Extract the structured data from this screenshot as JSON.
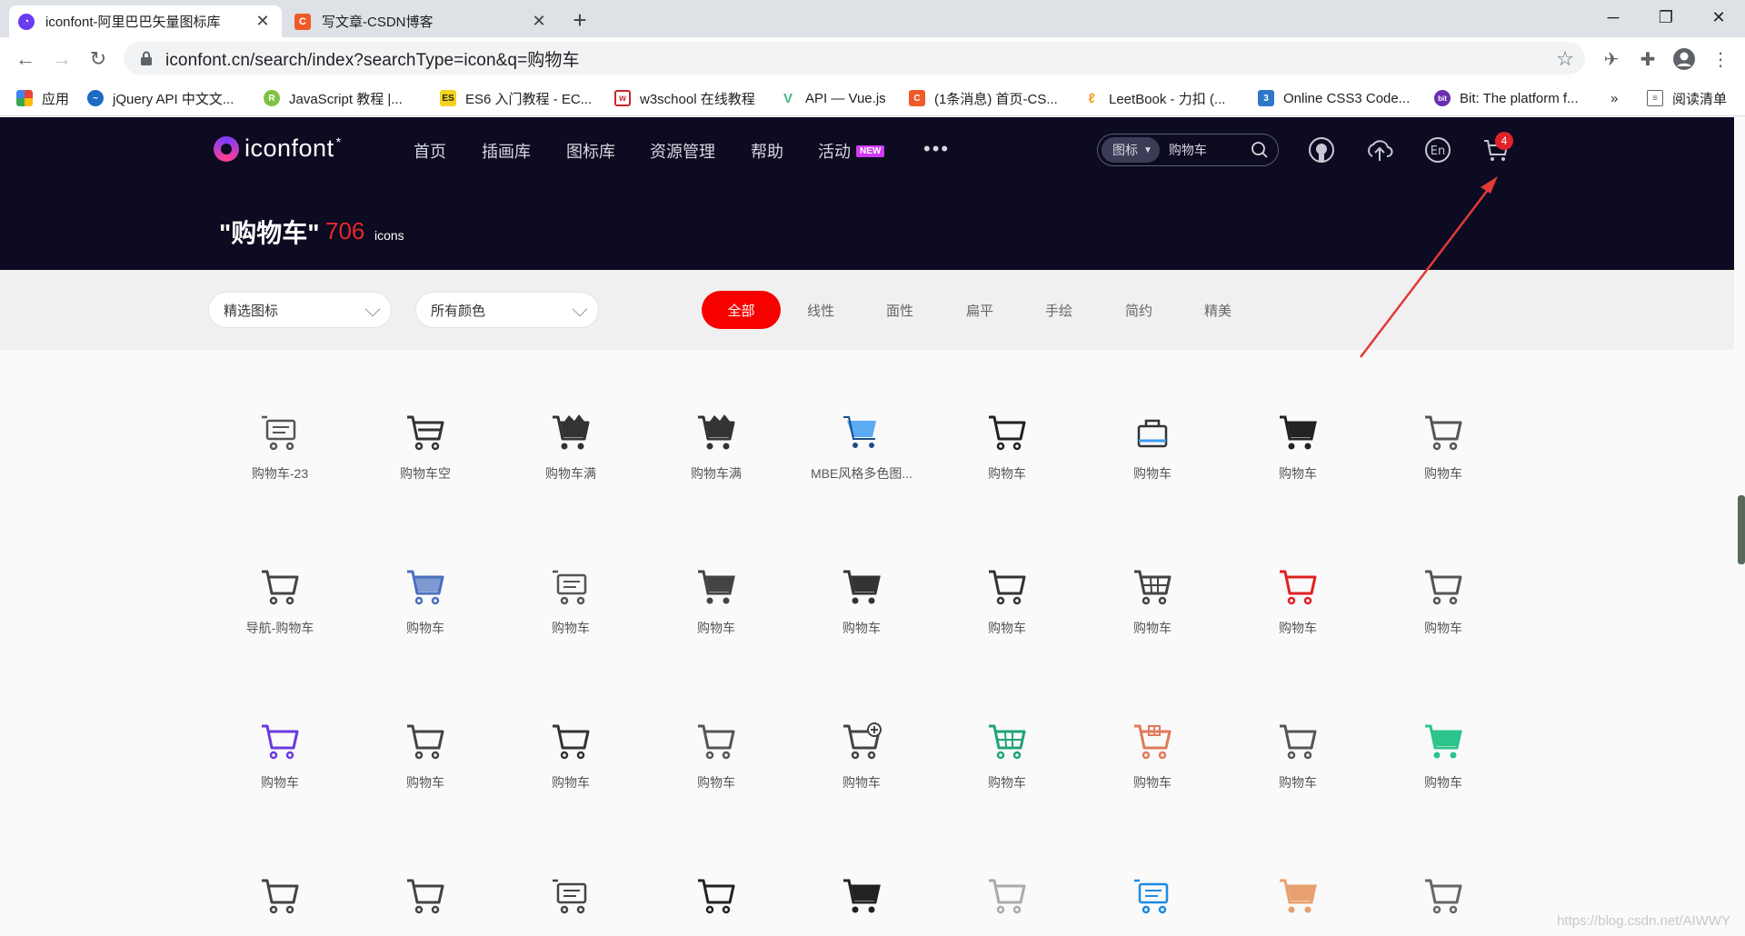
{
  "browser": {
    "tabs": [
      {
        "title": "iconfont-阿里巴巴矢量图标库",
        "active": true
      },
      {
        "title": "写文章-CSDN博客",
        "active": false
      }
    ],
    "url": "iconfont.cn/search/index?searchType=icon&q=购物车",
    "bookmarks": [
      "应用",
      "jQuery API 中文文...",
      "JavaScript 教程 |...",
      "ES6 入门教程 - EC...",
      "w3school 在线教程",
      "API — Vue.js",
      "(1条消息) 首页-CS...",
      "LeetBook - 力扣 (...",
      "Online CSS3 Code...",
      "Bit: The platform f...",
      "»",
      "阅读清单"
    ]
  },
  "site": {
    "logo": "iconfont",
    "nav": [
      "首页",
      "插画库",
      "图标库",
      "资源管理",
      "帮助",
      "活动"
    ],
    "nav_badge": "NEW",
    "search_type": "图标",
    "search_value": "购物车",
    "cart_count": "4",
    "result": {
      "query": "\"购物车\"",
      "count": "706",
      "unit": "icons"
    },
    "filters": {
      "featured": "精选图标",
      "colors": "所有颜色"
    },
    "style_tabs": [
      "全部",
      "线性",
      "面性",
      "扁平",
      "手绘",
      "简约",
      "精美"
    ]
  },
  "icons": [
    {
      "label": "购物车-23",
      "icon": "cart-list-icon",
      "color": "#555555"
    },
    {
      "label": "购物车空",
      "icon": "cart-empty-icon",
      "color": "#333333"
    },
    {
      "label": "购物车满",
      "icon": "cart-full-icon",
      "color": "#333333"
    },
    {
      "label": "购物车满",
      "icon": "cart-full-icon",
      "color": "#333333"
    },
    {
      "label": "MBE风格多色图...",
      "icon": "cart-mbe-icon",
      "color": "#3d9cf0"
    },
    {
      "label": "购物车",
      "icon": "cart-icon",
      "color": "#222222"
    },
    {
      "label": "购物车",
      "icon": "basket-icon",
      "color": "#333333"
    },
    {
      "label": "购物车",
      "icon": "cart-solid-icon",
      "color": "#222222"
    },
    {
      "label": "购物车",
      "icon": "cart-outline-icon",
      "color": "#555555"
    },
    {
      "label": "导航-购物车",
      "icon": "cart-outline-icon",
      "color": "#444444"
    },
    {
      "label": "购物车",
      "icon": "cart-blue-icon",
      "color": "#4a6fc0"
    },
    {
      "label": "购物车",
      "icon": "cart-list-icon",
      "color": "#555555"
    },
    {
      "label": "购物车",
      "icon": "cart-solid-icon",
      "color": "#444444"
    },
    {
      "label": "购物车",
      "icon": "cart-solid-icon",
      "color": "#333333"
    },
    {
      "label": "购物车",
      "icon": "cart-outline-icon",
      "color": "#333333"
    },
    {
      "label": "购物车",
      "icon": "cart-grid-icon",
      "color": "#444444"
    },
    {
      "label": "购物车",
      "icon": "cart-outline-icon",
      "color": "#e02020"
    },
    {
      "label": "购物车",
      "icon": "cart-outline-icon",
      "color": "#555555"
    },
    {
      "label": "购物车",
      "icon": "cart-outline-icon",
      "color": "#6a3be0"
    },
    {
      "label": "购物车",
      "icon": "cart-outline-icon",
      "color": "#444444"
    },
    {
      "label": "购物车",
      "icon": "cart-outline-icon",
      "color": "#333333"
    },
    {
      "label": "购物车",
      "icon": "cart-outline-icon",
      "color": "#555555"
    },
    {
      "label": "购物车",
      "icon": "cart-add-icon",
      "color": "#444444"
    },
    {
      "label": "购物车",
      "icon": "cart-grid-icon",
      "color": "#21a37a"
    },
    {
      "label": "购物车",
      "icon": "cart-gift-icon",
      "color": "#e07a5a"
    },
    {
      "label": "购物车",
      "icon": "cart-outline-icon",
      "color": "#555555"
    },
    {
      "label": "购物车",
      "icon": "cart-solid-icon",
      "color": "#2bc48a"
    },
    {
      "label": "",
      "icon": "cart-outline-icon",
      "color": "#444444"
    },
    {
      "label": "",
      "icon": "cart-outline-icon",
      "color": "#444444"
    },
    {
      "label": "",
      "icon": "cart-list-icon",
      "color": "#444444"
    },
    {
      "label": "",
      "icon": "cart-outline-icon",
      "color": "#222222"
    },
    {
      "label": "",
      "icon": "cart-solid-icon",
      "color": "#222222"
    },
    {
      "label": "",
      "icon": "cart-outline-icon",
      "color": "#aaaaaa"
    },
    {
      "label": "",
      "icon": "cart-list-icon",
      "color": "#1e8ae0"
    },
    {
      "label": "",
      "icon": "cart-solid-icon",
      "color": "#e8a070"
    },
    {
      "label": "",
      "icon": "cart-outline-icon",
      "color": "#666666"
    }
  ],
  "watermark": "https://blog.csdn.net/AIWWY"
}
